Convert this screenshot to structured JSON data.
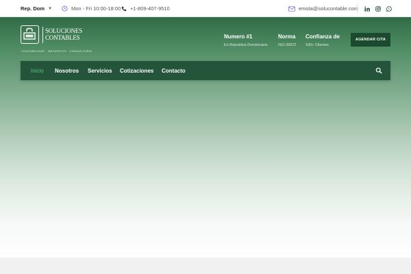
{
  "topbar": {
    "region": "Rep. Dom",
    "hours": "Mon - Fri 10:00-18:00",
    "phone": "+1-809-407-9510",
    "email": "emota@solucontable.com",
    "social": [
      "linkedin-icon",
      "instagram-icon",
      "whatsapp-icon"
    ]
  },
  "logo": {
    "name_line1": "SOLUCIONES",
    "name_line2": "CONTABLES",
    "tagline": "CONTABILIDAD · IMPUESTOS · CONSULTORIA"
  },
  "header": {
    "stats": [
      {
        "title": "Numero #1",
        "subtitle": "En Republica Dominicana"
      },
      {
        "title": "Norma",
        "subtitle": "ISO 20022"
      },
      {
        "title": "Confianza de",
        "subtitle": "100+ Clientes"
      }
    ],
    "cta_label": "AGENDAR CITA"
  },
  "nav": {
    "items": [
      {
        "label": "Inicio",
        "active": true
      },
      {
        "label": "Nosotros"
      },
      {
        "label": "Servicios"
      },
      {
        "label": "Cotizaciones"
      },
      {
        "label": "Contacto"
      }
    ]
  },
  "colors": {
    "brand_dark": "#1b4a2e",
    "nav_bg": "#24553a",
    "active_link": "#57c27e",
    "hero_top": "#2f6b45"
  }
}
